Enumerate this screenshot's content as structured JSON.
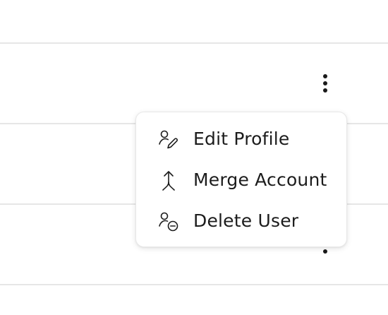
{
  "row_actions": {
    "menu_icon": "more-vertical-icon"
  },
  "dropdown": {
    "items": [
      {
        "label": "Edit Profile",
        "icon": "user-edit-icon"
      },
      {
        "label": "Merge Account",
        "icon": "merge-arrow-icon"
      },
      {
        "label": "Delete User",
        "icon": "user-remove-icon"
      }
    ]
  },
  "colors": {
    "text": "#1c1c1c",
    "divider": "#e6e6e6",
    "menu_border": "#e8e8e8",
    "background": "#ffffff"
  }
}
